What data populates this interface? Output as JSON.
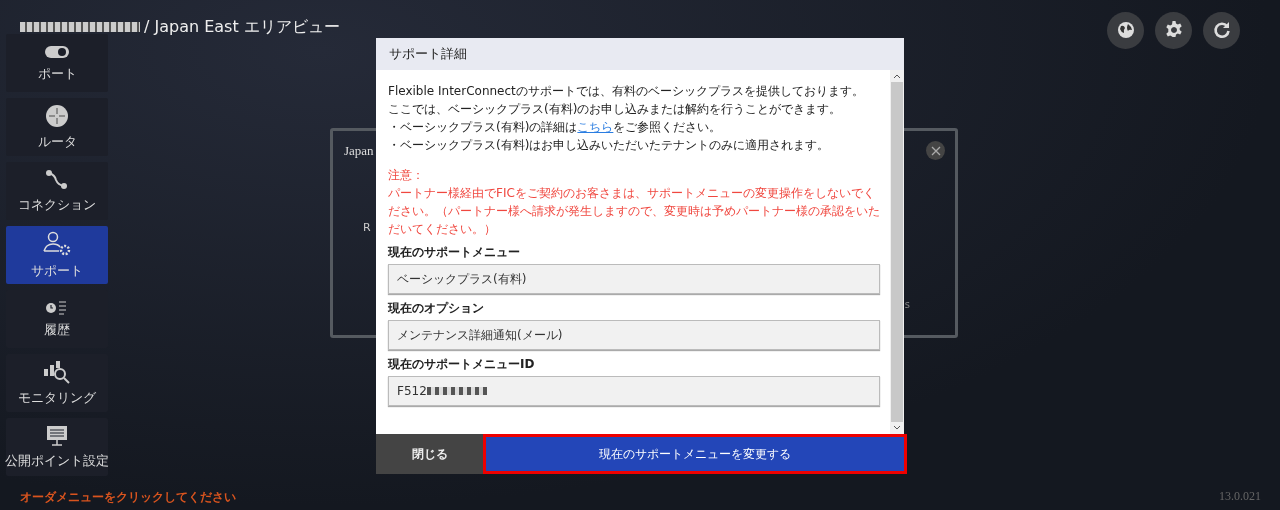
{
  "header": {
    "title": "/ Japan East エリアビュー",
    "redacted": true
  },
  "sidebar": {
    "items": [
      {
        "label": "ポート",
        "kind": "port",
        "selected": false
      },
      {
        "label": "ルータ",
        "kind": "router",
        "selected": false
      },
      {
        "label": "コネクション",
        "kind": "connection",
        "selected": false
      },
      {
        "label": "サポート",
        "kind": "support",
        "selected": true
      },
      {
        "label": "履歴",
        "kind": "history",
        "selected": false
      },
      {
        "label": "モニタリング",
        "kind": "monitoring",
        "selected": false
      },
      {
        "label": "公開ポイント設定",
        "kind": "display",
        "selected": false
      }
    ]
  },
  "background_panel": {
    "title": "Japan",
    "label_left": "R",
    "label_right": "s"
  },
  "dialog": {
    "title": "サポート詳細",
    "lines": [
      {
        "text": "Flexible InterConnectのサポートでは、有料のベーシックプラスを提供しております。"
      },
      {
        "text": "ここでは、ベーシックプラス(有料)のお申し込みまたは解約を行うことができます。"
      },
      {
        "text": "・ベーシックプラス(有料)の詳細は",
        "link": "こちら",
        "after": "をご参照ください。"
      },
      {
        "text": "・ベーシックプラス(有料)はお申し込みいただいたテナントのみに適用されます。"
      }
    ],
    "notice": {
      "title": "注意：",
      "text": "パートナー様経由でFICをご契約のお客さまは、サポートメニューの変更操作をしないでください。（パートナー様へ請求が発生しますので、変更時は予めパートナー様の承認をいただいてください。）"
    },
    "fields": [
      {
        "label": "現在のサポートメニュー",
        "value": "ベーシックプラス(有料)",
        "redacted": false
      },
      {
        "label": "現在のオプション",
        "value": "メンテナンス詳細通知(メール)",
        "redacted": false
      },
      {
        "label": "現在のサポートメニューID",
        "value": "F512",
        "redacted": true
      }
    ],
    "close_button": "閉じる",
    "primary_button": {
      "label": "現在のサポートメニューを変更する",
      "highlighted": true
    }
  },
  "hint": "オーダメニューをクリックしてください",
  "version": "13.0.021"
}
